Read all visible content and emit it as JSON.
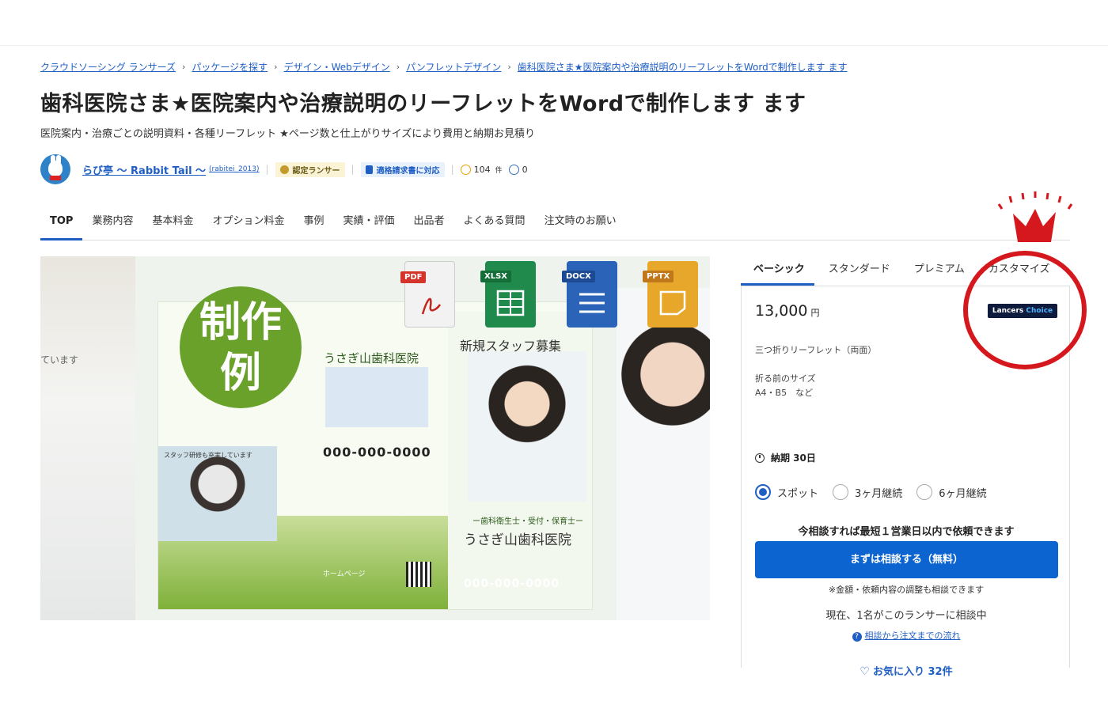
{
  "breadcrumb": [
    "クラウドソーシング ランサーズ",
    "パッケージを探す",
    "デザイン・Webデザイン",
    "パンフレットデザイン",
    "歯科医院さま★医院案内や治療説明のリーフレットをWordで制作します ます"
  ],
  "page": {
    "title": "歯科医院さま★医院案内や治療説明のリーフレットをWordで制作します ます",
    "subtitle": "医院案内・治療ごとの説明資料・各種リーフレット ★ページ数と仕上がりサイズにより費用と納期お見積り"
  },
  "seller": {
    "name": "らび亭 〜 Rabbit Tail 〜",
    "id": "(rabitei_2013)",
    "badge_certified": "認定ランサー",
    "badge_invoice": "適格請求書に対応",
    "good_count": "104",
    "good_unit": "件",
    "bad_count": "0"
  },
  "tabs": [
    "TOP",
    "業務内容",
    "基本料金",
    "オプション料金",
    "事例",
    "実績・評価",
    "出品者",
    "よくある質問",
    "注文時のお願い"
  ],
  "hero": {
    "circle_text_1": "制作",
    "circle_text_2": "例",
    "file_badges": [
      "PDF",
      "XLSX",
      "DOCX",
      "PPTX"
    ],
    "file_colors": [
      "#e4e4e4",
      "#1f8a4c",
      "#2a63b8",
      "#e7a72a"
    ],
    "clinic_name": "うさぎ山歯科医院",
    "recruit_text": "新規スタッフ募集",
    "phone_left": "000-000-0000",
    "phone_right": "000-000-0000",
    "staff_caption": "スタッフ研修も充実しています",
    "roles": "ー歯科衛生士・受付・保育士ー",
    "homepage": "ホームページ",
    "left_fragment": "ています"
  },
  "plan": {
    "tabs": [
      "ベーシック",
      "スタンダード",
      "プレミアム",
      "カスタマイズ"
    ],
    "price": "13,000",
    "currency": "円",
    "choice_badge_a": "Lancers",
    "choice_badge_b": "Choice",
    "desc": "三つ折りリーフレット（両面）",
    "size_label": "折る前のサイズ",
    "size_value": "A4・B5　など",
    "delivery": "納期 30日",
    "radio_options": [
      "スポット",
      "3ヶ月継続",
      "6ヶ月継続"
    ],
    "radio_selected": "スポット",
    "consult_note": "今相談すれば最短１営業日以内で依頼できます",
    "cta": "まずは相談する（無料）",
    "cta_sub": "※金額・依頼内容の調整も相談できます",
    "now_consulting": "現在、1名がこのランサーに相談中",
    "flow_link": "相談から注文までの流れ",
    "favorite": "お気に入り 32件"
  },
  "colors": {
    "link": "#1f5fc4",
    "cta": "#0b64cf",
    "annotation_red": "#d5181d",
    "hero_green": "#6aa12a"
  }
}
